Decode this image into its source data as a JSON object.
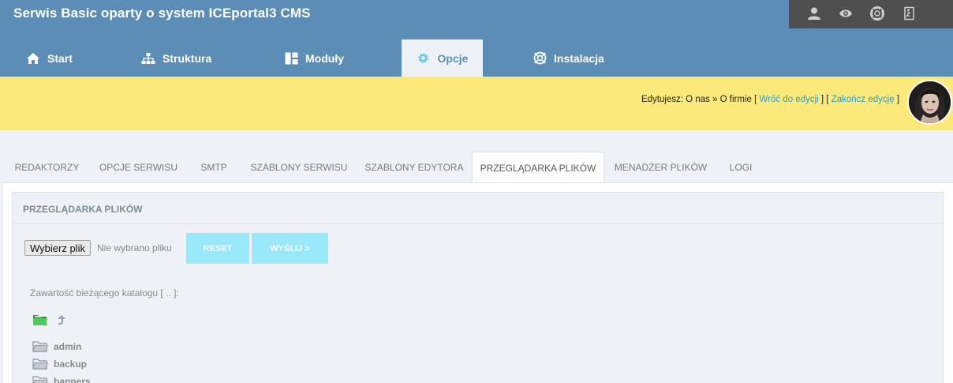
{
  "header": {
    "title": "Serwis Basic oparty o system ICEportal3 CMS",
    "toolbar_icons": [
      "user-icon",
      "eye-icon",
      "lifebuoy-icon",
      "exit-icon"
    ]
  },
  "main_nav": [
    {
      "label": "Start",
      "icon": "home-icon"
    },
    {
      "label": "Struktura",
      "icon": "sitemap-icon"
    },
    {
      "label": "Moduły",
      "icon": "modules-icon"
    },
    {
      "label": "Opcje",
      "icon": "gear-icon",
      "active": true
    },
    {
      "label": "Instalacja",
      "icon": "install-icon"
    }
  ],
  "edit_bar": {
    "prefix": "Edytujesz: O nas » O firmie [ ",
    "back_link": "Wróć do edycji",
    "mid": " ] [ ",
    "end_link": "Zakończ edycję",
    "suffix": " ]"
  },
  "subtabs": [
    {
      "label": "REDAKTORZY"
    },
    {
      "label": "OPCJE SERWISU"
    },
    {
      "label": "SMTP"
    },
    {
      "label": "SZABLONY SERWISU"
    },
    {
      "label": "SZABLONY EDYTORA"
    },
    {
      "label": "PRZEGLĄDARKA PLIKÓW",
      "active": true
    },
    {
      "label": "MENADŻER PLIKÓW"
    },
    {
      "label": "LOGI"
    }
  ],
  "panel": {
    "title": "PRZEGLĄDARKA PLIKÓW",
    "file_button": "Wybierz plik",
    "file_status": "Nie wybrano pliku",
    "reset_label": "RESET",
    "send_label": "WYŚLIJ >",
    "dir_label": "Zawartość bieżącego katalogu [ .. ]:",
    "folders": [
      "admin",
      "backup",
      "banners"
    ]
  },
  "colors": {
    "header": "#5b8db7",
    "toolbar": "#4f4f4f",
    "edit_bar": "#fbea7a",
    "link": "#2a9bd3",
    "action_button": "#99e8fb"
  }
}
